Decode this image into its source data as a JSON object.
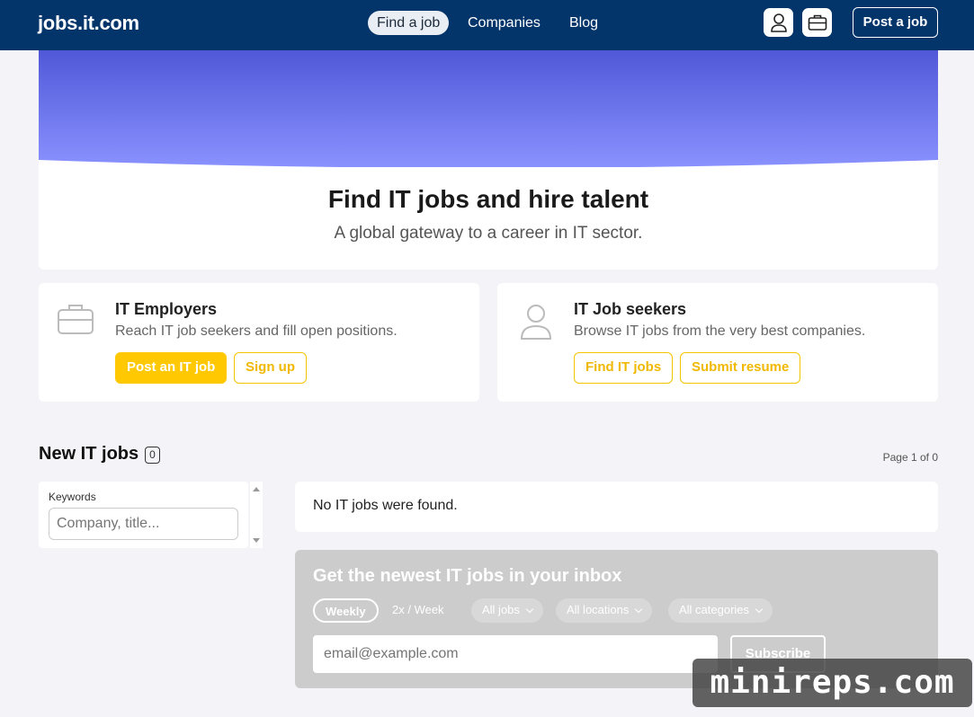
{
  "header": {
    "logo": "jobs.it.com",
    "nav": [
      {
        "label": "Find a job",
        "active": true
      },
      {
        "label": "Companies",
        "active": false
      },
      {
        "label": "Blog",
        "active": false
      }
    ],
    "post_label": "Post a job",
    "icons": [
      "user-icon",
      "briefcase-icon"
    ]
  },
  "hero": {
    "title": "Find IT jobs and hire talent",
    "subtitle": "A global gateway to a career in IT sector."
  },
  "cards": [
    {
      "icon": "briefcase-icon",
      "title": "IT Employers",
      "text": "Reach IT job seekers and fill open positions.",
      "buttons": [
        "Post an IT job",
        "Sign up"
      ]
    },
    {
      "icon": "user-icon",
      "title": "IT Job seekers",
      "text": "Browse IT jobs from the very best companies.",
      "buttons": [
        "Find IT jobs",
        "Submit resume"
      ]
    }
  ],
  "jobs": {
    "title": "New IT jobs",
    "count": "0",
    "page_info": "Page 1 of 0",
    "empty_text": "No IT jobs were found."
  },
  "filter": {
    "label": "Keywords",
    "placeholder": "Company, title..."
  },
  "newsletter": {
    "title": "Get the newest IT jobs in your inbox",
    "frequency": [
      "Weekly",
      "2x / Week"
    ],
    "dropdowns": [
      "All jobs",
      "All locations",
      "All categories"
    ],
    "email_placeholder": "email@example.com",
    "subscribe_label": "Subscribe"
  },
  "watermark": "minireps.com",
  "colors": {
    "header_bg": "#03356b",
    "accent": "#ffc800",
    "hero_top": "#5058d8",
    "hero_bottom": "#8a92ff"
  }
}
